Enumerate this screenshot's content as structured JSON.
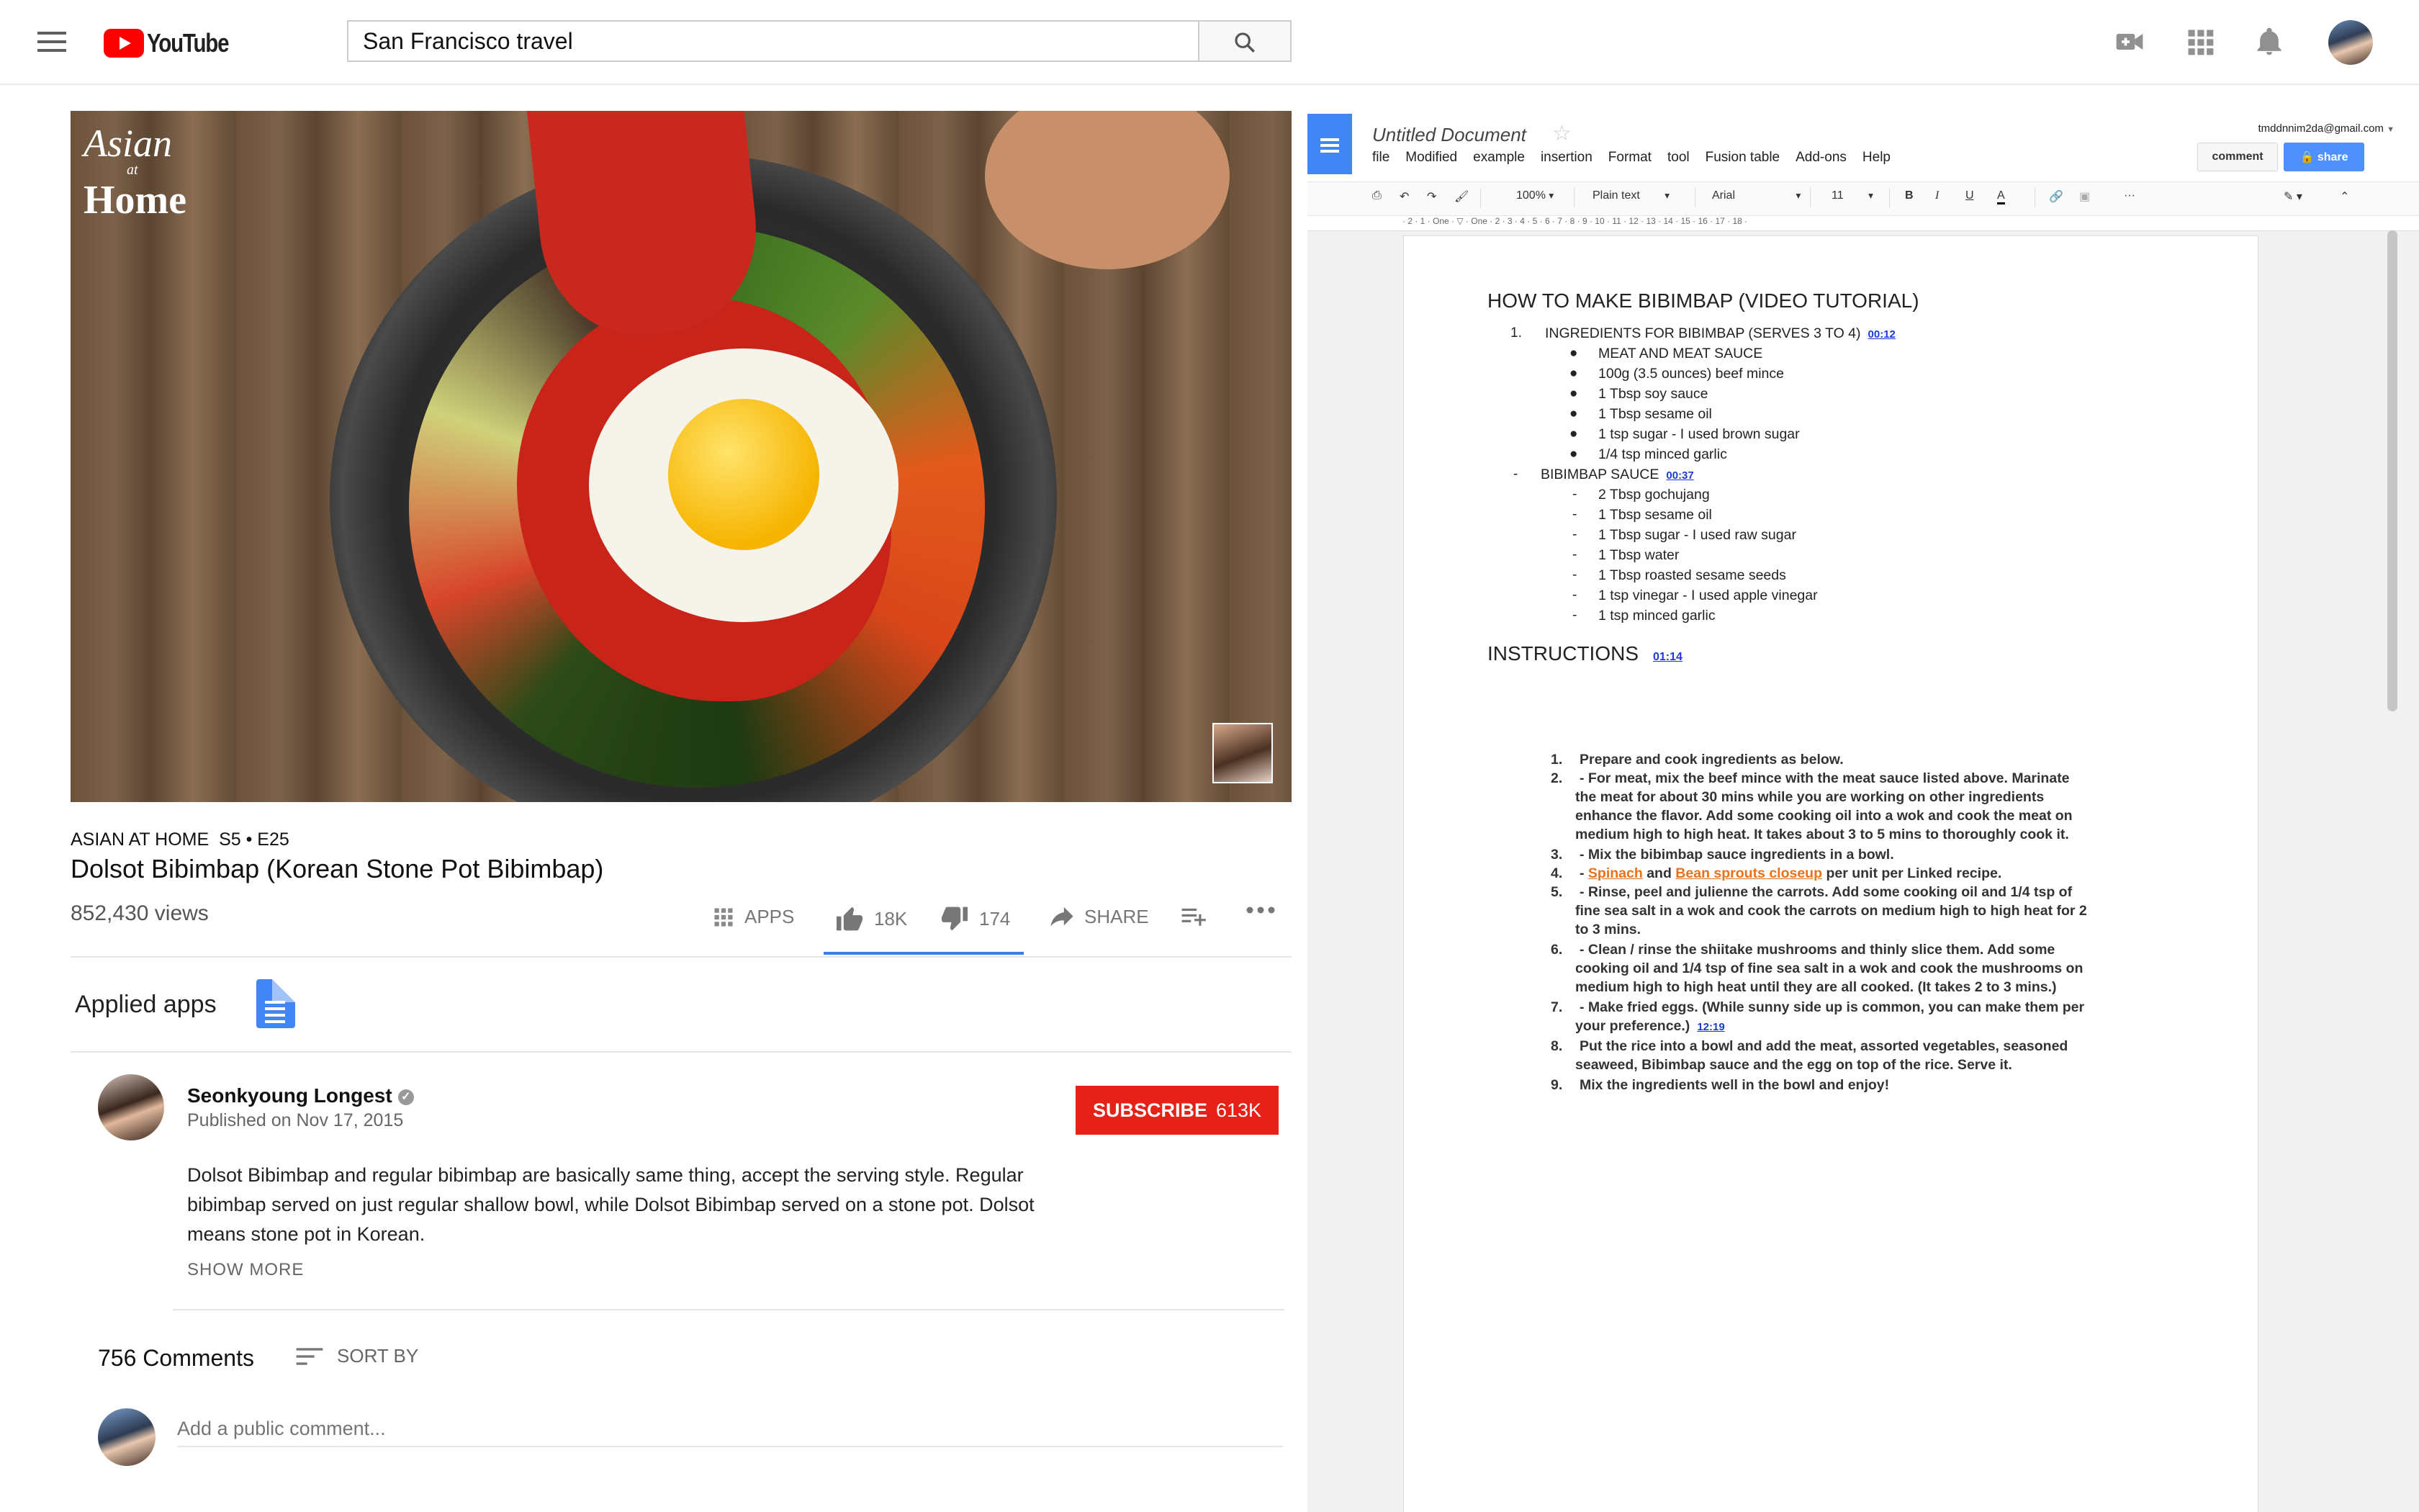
{
  "youtube": {
    "logo_text": "YouTube",
    "search_value": "San Francisco travel",
    "icons": [
      "hamburger-icon",
      "search-icon",
      "add-video-icon",
      "apps-grid-icon",
      "bell-icon",
      "avatar"
    ]
  },
  "video": {
    "brand_line1": "Asian",
    "brand_line2": "at",
    "brand_line3": "Home"
  },
  "meta": {
    "show_info": "ASIAN AT HOME  S5 • E25",
    "title": "Dolsot Bibimbap (Korean Stone Pot Bibimbap)",
    "views": "852,430 views"
  },
  "actions": {
    "apps": "APPS",
    "likes": "18K",
    "dislikes": "174",
    "share": "SHARE"
  },
  "applied_apps_label": "Applied apps",
  "channel": {
    "name": "Seonkyoung Longest",
    "published": "Published on Nov 17, 2015",
    "subscribe_label": "SUBSCRIBE",
    "subscriber_count": "613K",
    "description": "Dolsot Bibimbap and regular bibimbap are basically same thing, accept the serving style. Regular bibimbap served on just regular shallow bowl, while Dolsot Bibimbap served on a stone pot. Dolsot means stone pot in Korean.",
    "show_more": "SHOW MORE"
  },
  "comments": {
    "count": "756 Comments",
    "sort_label": "SORT BY",
    "placeholder": "Add a public comment..."
  },
  "docs": {
    "title": "Untitled Document",
    "menu": [
      "file",
      "Modified",
      "example",
      "insertion",
      "Format",
      "tool",
      "Fusion table",
      "Add-ons",
      "Help"
    ],
    "email": "tmddnnim2da@gmail.com",
    "comment_btn": "comment",
    "share_btn": "share",
    "toolbar": {
      "zoom": "100%",
      "style": "Plain text",
      "font": "Arial",
      "size": "11"
    },
    "ruler": "· 2 · 1 · One · ▽ · One · 2 · 3 · 4 · 5 · 6 · 7 · 8 · 9 · 10 · 11 · 12 · 13 · 14 · 15 · 16 · 17 · 18 ·",
    "heading": "HOW TO MAKE BIBIMBAP (VIDEO TUTORIAL)",
    "section1": {
      "num": "1.",
      "text": "INGREDIENTS FOR BIBIMBAP (SERVES 3 TO 4)",
      "ts": "00:12"
    },
    "ingredients": [
      "MEAT AND MEAT SAUCE",
      "100g (3.5 ounces) beef mince",
      "1 Tbsp soy sauce",
      "1 Tbsp sesame oil",
      "1 tsp sugar - I used brown sugar",
      "1/4 tsp minced garlic"
    ],
    "section2": {
      "text": "BIBIMBAP SAUCE",
      "ts": "00:37"
    },
    "sauce": [
      "2 Tbsp gochujang",
      "1 Tbsp sesame oil",
      "1 Tbsp sugar - I used raw sugar",
      "1 Tbsp water",
      "1 Tbsp roasted sesame seeds",
      "1 tsp vinegar - I used apple vinegar",
      "1 tsp minced garlic"
    ],
    "instructions_heading": "INSTRUCTIONS",
    "instructions_ts": "01:14",
    "steps": {
      "s1": "Prepare and cook ingredients as below.",
      "s2a": "- For meat, mix the beef mince with the meat sauce listed above. Marinate",
      "s2b": "the meat for about 30 mins while you are working on other ingredients",
      "s2c": "enhance the flavor. Add some cooking oil into a wok and cook the meat on",
      "s2d": "medium high to high heat. It takes about 3 to 5 mins to thoroughly cook it.",
      "s3": "- Mix the bibimbap sauce ingredients in a bowl.",
      "s4_dash": "-",
      "s4_link1": "Spinach",
      "s4_and": "and",
      "s4_link2": "Bean sprouts closeup",
      "s4_rest": "per unit per Linked recipe.",
      "s5a": "- Rinse, peel and julienne the carrots. Add some cooking oil and 1/4 tsp of",
      "s5b": "fine sea salt in a wok and cook the carrots on medium high to high heat for 2",
      "s5c": "to 3 mins.",
      "s6a": "- Clean / rinse the shiitake mushrooms and thinly slice them. Add some",
      "s6b": "cooking oil and 1/4 tsp of fine sea salt in a wok and cook the mushrooms on",
      "s6c": "medium high to high heat until they are all cooked. (It takes 2 to 3 mins.)",
      "s7a": "- Make fried eggs. (While sunny side up is common, you can make them per",
      "s7b": "your preference.)",
      "s7_ts": "12:19",
      "s8a": "Put the rice into a bowl and add the meat, assorted vegetables, seasoned",
      "s8b": "seaweed, Bibimbap sauce and the egg on top of the rice. Serve it.",
      "s9": "Mix the ingredients well in the bowl and enjoy!"
    }
  }
}
